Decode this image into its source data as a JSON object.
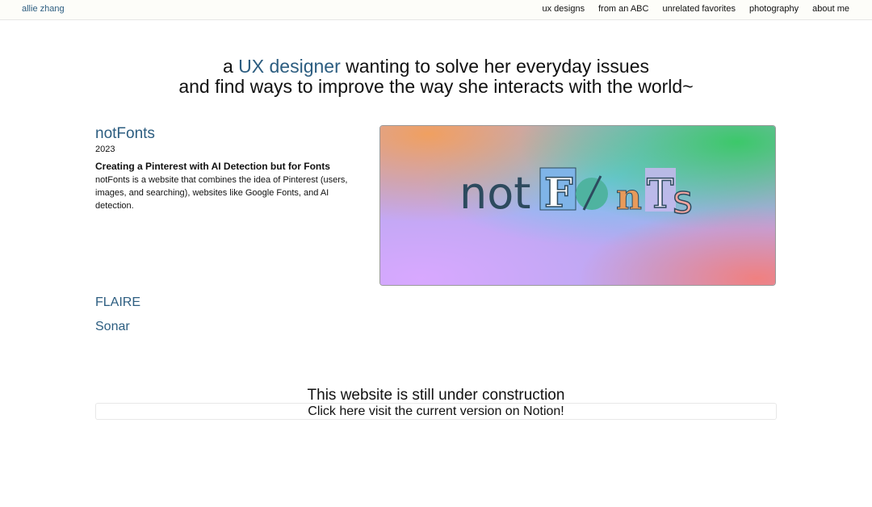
{
  "nav": {
    "brand": "allie zhang",
    "links": [
      {
        "label": "ux designs"
      },
      {
        "label": "from an ABC"
      },
      {
        "label": "unrelated favorites"
      },
      {
        "label": "photography"
      },
      {
        "label": "about me"
      }
    ]
  },
  "hero": {
    "prefix": "a ",
    "accent": "UX designer",
    "line1_rest": " wanting to solve her everyday issues",
    "line2": "and find ways to improve the way she interacts with the world~"
  },
  "project": {
    "title": "notFonts",
    "year": "2023",
    "subtitle": "Creating a Pinterest with AI Detection but for Fonts",
    "description": "notFonts is a website that combines the idea of Pinterest (users, images, and searching), websites like Google Fonts, and AI detection.",
    "logo": {
      "prefix": "not",
      "letters": [
        "F",
        "o",
        "n",
        "T",
        "s"
      ]
    }
  },
  "other_projects": [
    {
      "title": "FLAIRE"
    },
    {
      "title": "Sonar"
    }
  ],
  "footer": {
    "construction": "This website is still under construction",
    "notion_link": "Click here visit the current version on Notion!"
  },
  "colors": {
    "accent": "#2c5d80",
    "text": "#111111"
  }
}
